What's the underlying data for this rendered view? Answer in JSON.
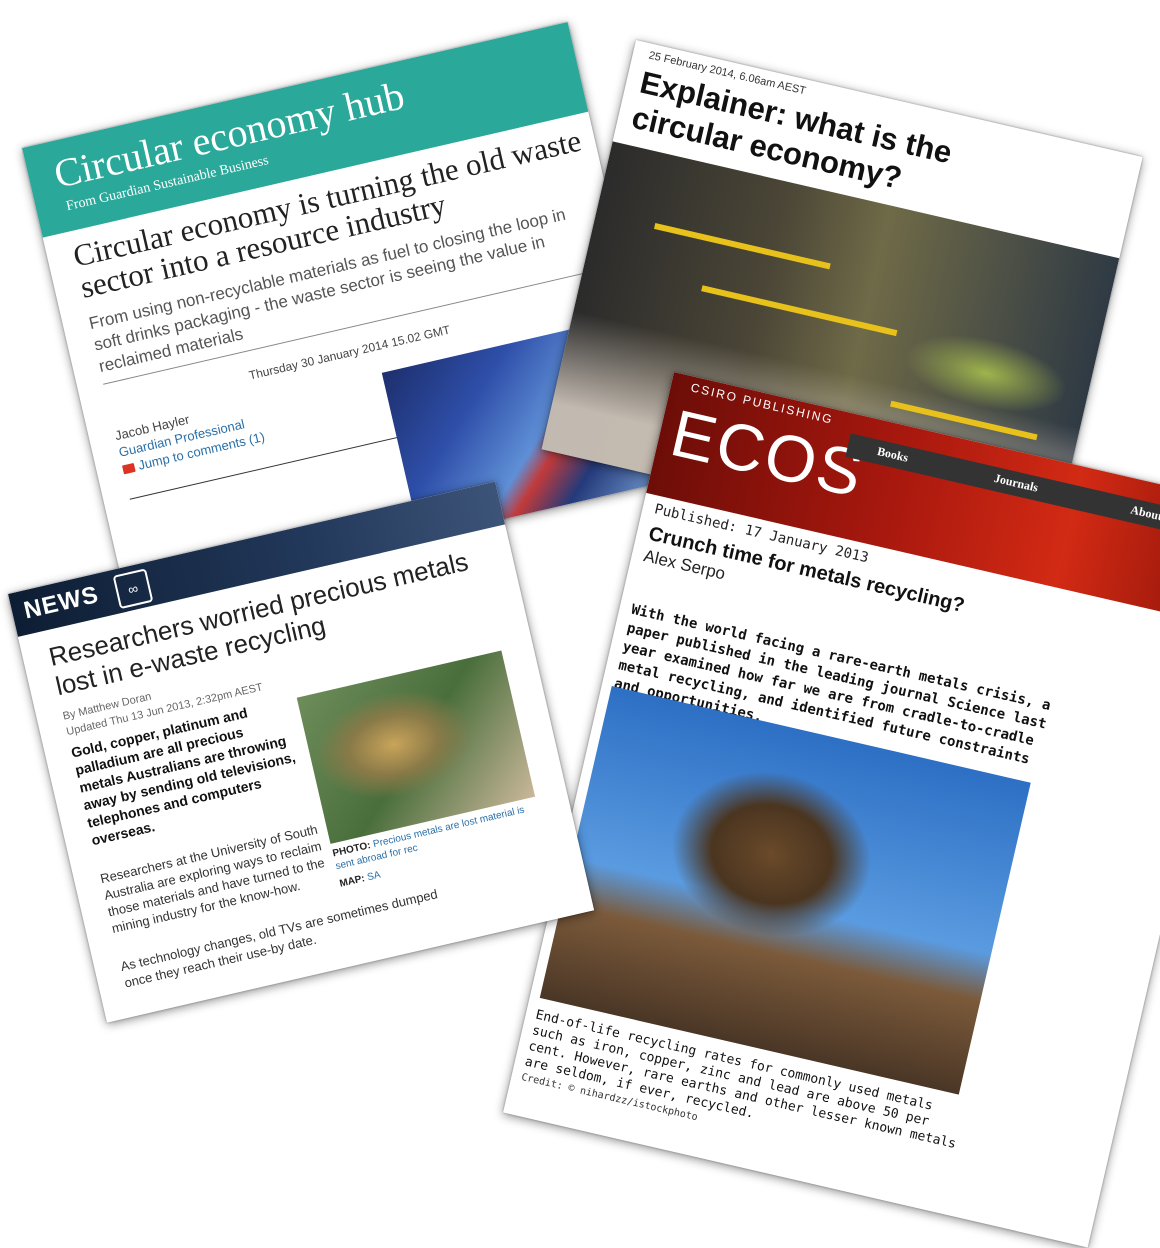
{
  "guardian": {
    "hub_title": "Circular economy hub",
    "hub_subtitle": "From Guardian Sustainable Business",
    "headline": "Circular economy is turning the old waste sector into a resource industry",
    "standfirst": "From using non-recyclable materials as fuel to closing the loop in soft drinks packaging - the waste sector is seeing the value in reclaimed materials",
    "date": "Thursday 30 January 2014 15.02 GMT",
    "author": "Jacob Hayler",
    "source": "Guardian Professional",
    "comments": "Jump to comments (1)"
  },
  "explainer": {
    "date": "25 February 2014, 6.06am AEST",
    "title": "Explainer: what is the circular economy?"
  },
  "ecos": {
    "publisher": "CSIRO PUBLISHING",
    "logo": "ECOS",
    "nav": [
      "Books",
      "Journals",
      "About Us"
    ],
    "published": "Published: 17 January 2013",
    "headline": "Crunch time for metals recycling?",
    "author": "Alex Serpo",
    "lead": "With the world facing a rare-earth metals crisis, a paper published in the leading journal Science last year examined how far we are from cradle-to-cradle metal recycling, and identified future constraints and opportunities.",
    "caption": "End-of-life recycling rates for commonly used metals such as iron, copper, zinc and lead are above 50 per cent. However, rare earths and other lesser known metals are seldom, if ever, recycled.",
    "credit": "Credit: © nihardzz/istockphoto"
  },
  "abc": {
    "brand": "NEWS",
    "headline": "Researchers worried precious metals lost in e-waste recycling",
    "byline": "By Matthew Doran",
    "updated": "Updated Thu 13 Jun 2013, 2:32pm AEST",
    "lead": "Gold, copper, platinum and palladium are all precious metals Australians are throwing away by sending old televisions, telephones and computers overseas.",
    "body1": "Researchers at the University of South Australia are exploring ways to reclaim those materials and have turned to the mining industry for the know-how.",
    "body2": "As technology changes, old TVs are sometimes dumped once they reach their use-by date.",
    "photo_label": "PHOTO:",
    "photo_caption": "Precious metals are lost material is sent abroad for rec",
    "map_label": "MAP:",
    "map_value": "SA"
  }
}
